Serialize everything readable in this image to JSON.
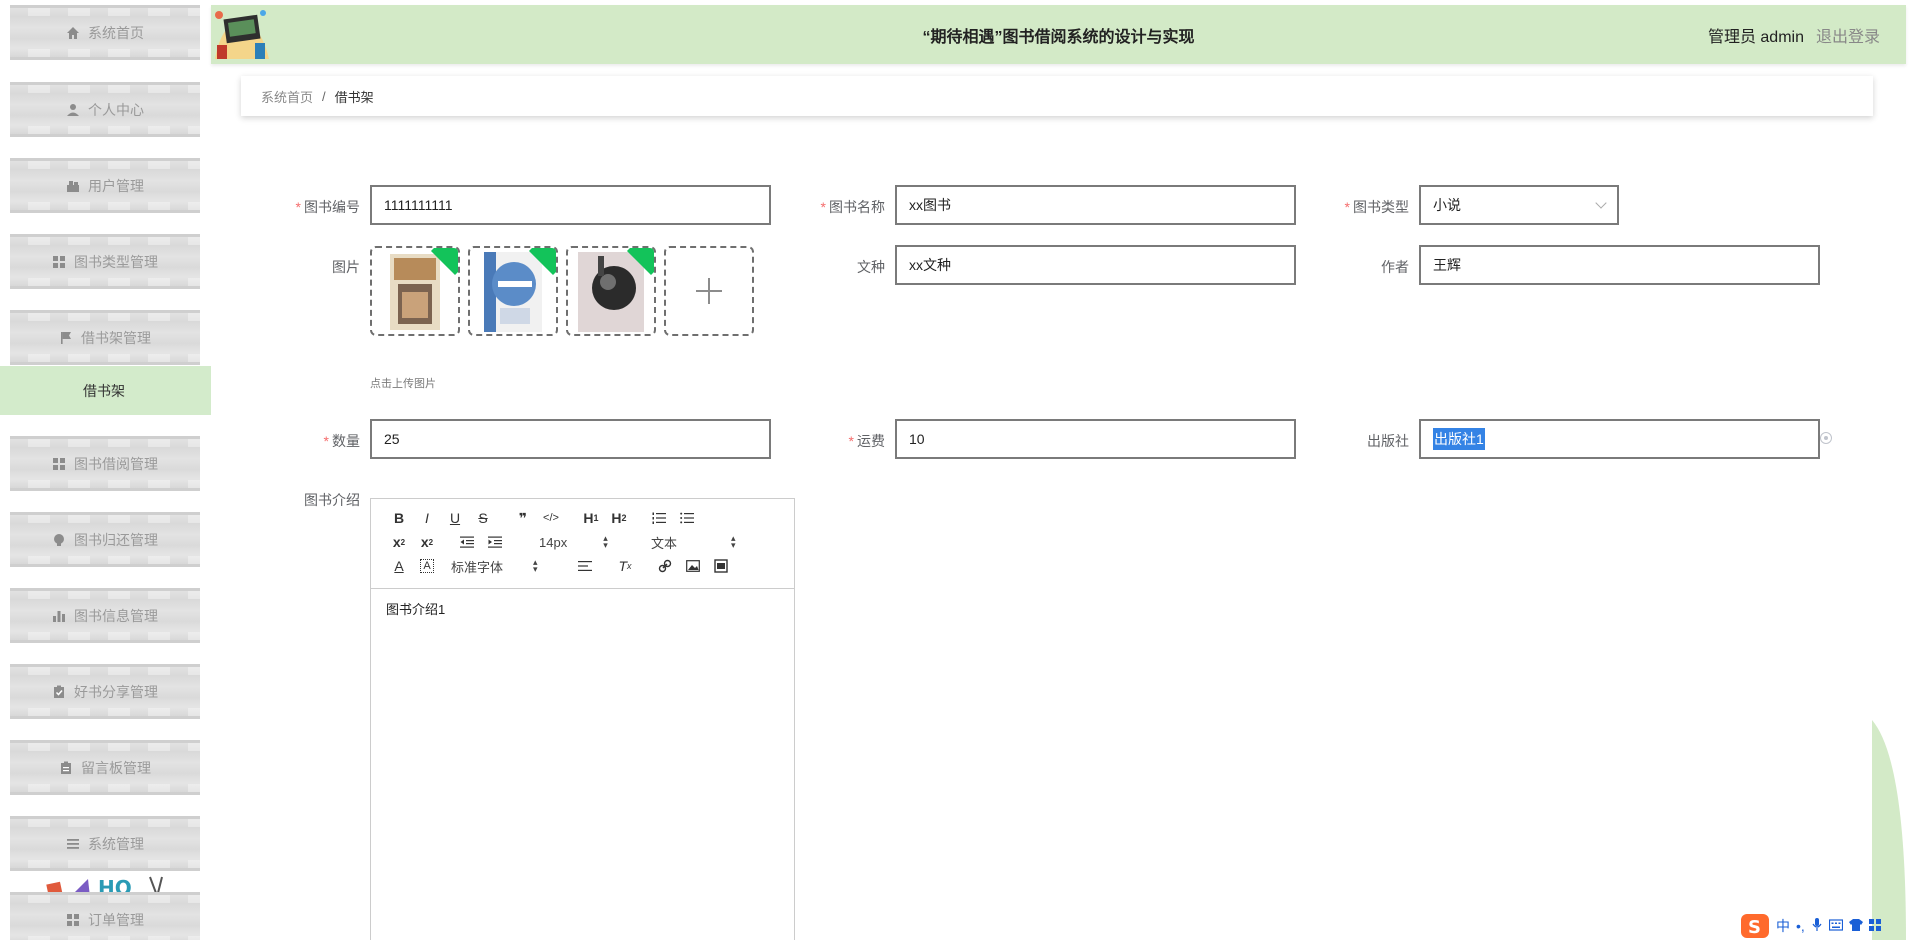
{
  "header": {
    "title": "“期待相遇”图书借阅系统的设计与实现",
    "user_label": "管理员 admin",
    "logout": "退出登录"
  },
  "sidebar": {
    "items": [
      {
        "label": "系统首页",
        "icon": "home-icon"
      },
      {
        "label": "个人中心",
        "icon": "user-icon"
      },
      {
        "label": "用户管理",
        "icon": "users-icon"
      },
      {
        "label": "图书类型管理",
        "icon": "grid-icon"
      },
      {
        "label": "借书架管理",
        "icon": "flag-icon"
      },
      {
        "label": "图书借阅管理",
        "icon": "grid-icon"
      },
      {
        "label": "图书归还管理",
        "icon": "bulb-icon"
      },
      {
        "label": "图书信息管理",
        "icon": "bar-chart-icon"
      },
      {
        "label": "好书分享管理",
        "icon": "clipboard-check-icon"
      },
      {
        "label": "留言板管理",
        "icon": "clipboard-icon"
      },
      {
        "label": "系统管理",
        "icon": "list-icon"
      },
      {
        "label": "订单管理",
        "icon": "grid-icon"
      }
    ],
    "active_submenu": "借书架"
  },
  "breadcrumb": {
    "home": "系统首页",
    "separator": "/",
    "current": "借书架"
  },
  "form": {
    "book_no": {
      "label": "图书编号",
      "value": "1111111111",
      "required": true
    },
    "book_name": {
      "label": "图书名称",
      "value": "xx图书",
      "required": true
    },
    "book_type": {
      "label": "图书类型",
      "value": "小说",
      "required": true
    },
    "images": {
      "label": "图片",
      "count": 3,
      "tip": "点击上传图片"
    },
    "language": {
      "label": "文种",
      "value": "xx文种"
    },
    "author": {
      "label": "作者",
      "value": "王辉"
    },
    "quantity": {
      "label": "数量",
      "value": "25",
      "required": true
    },
    "shipping": {
      "label": "运费",
      "value": "10",
      "required": true
    },
    "publisher": {
      "label": "出版社",
      "value": "出版社1"
    },
    "intro": {
      "label": "图书介绍",
      "content": "图书介绍1"
    }
  },
  "editor": {
    "font_size": "14px",
    "header_picker": "文本",
    "font_family": "标准字体"
  },
  "colors": {
    "header_bg": "#d3eac7",
    "active_submenu_bg": "#d3ebcb",
    "required_star": "#f56c6c",
    "upload_badge": "#13c35a",
    "selection": "#3483e5"
  },
  "ime": {
    "label": "中"
  }
}
